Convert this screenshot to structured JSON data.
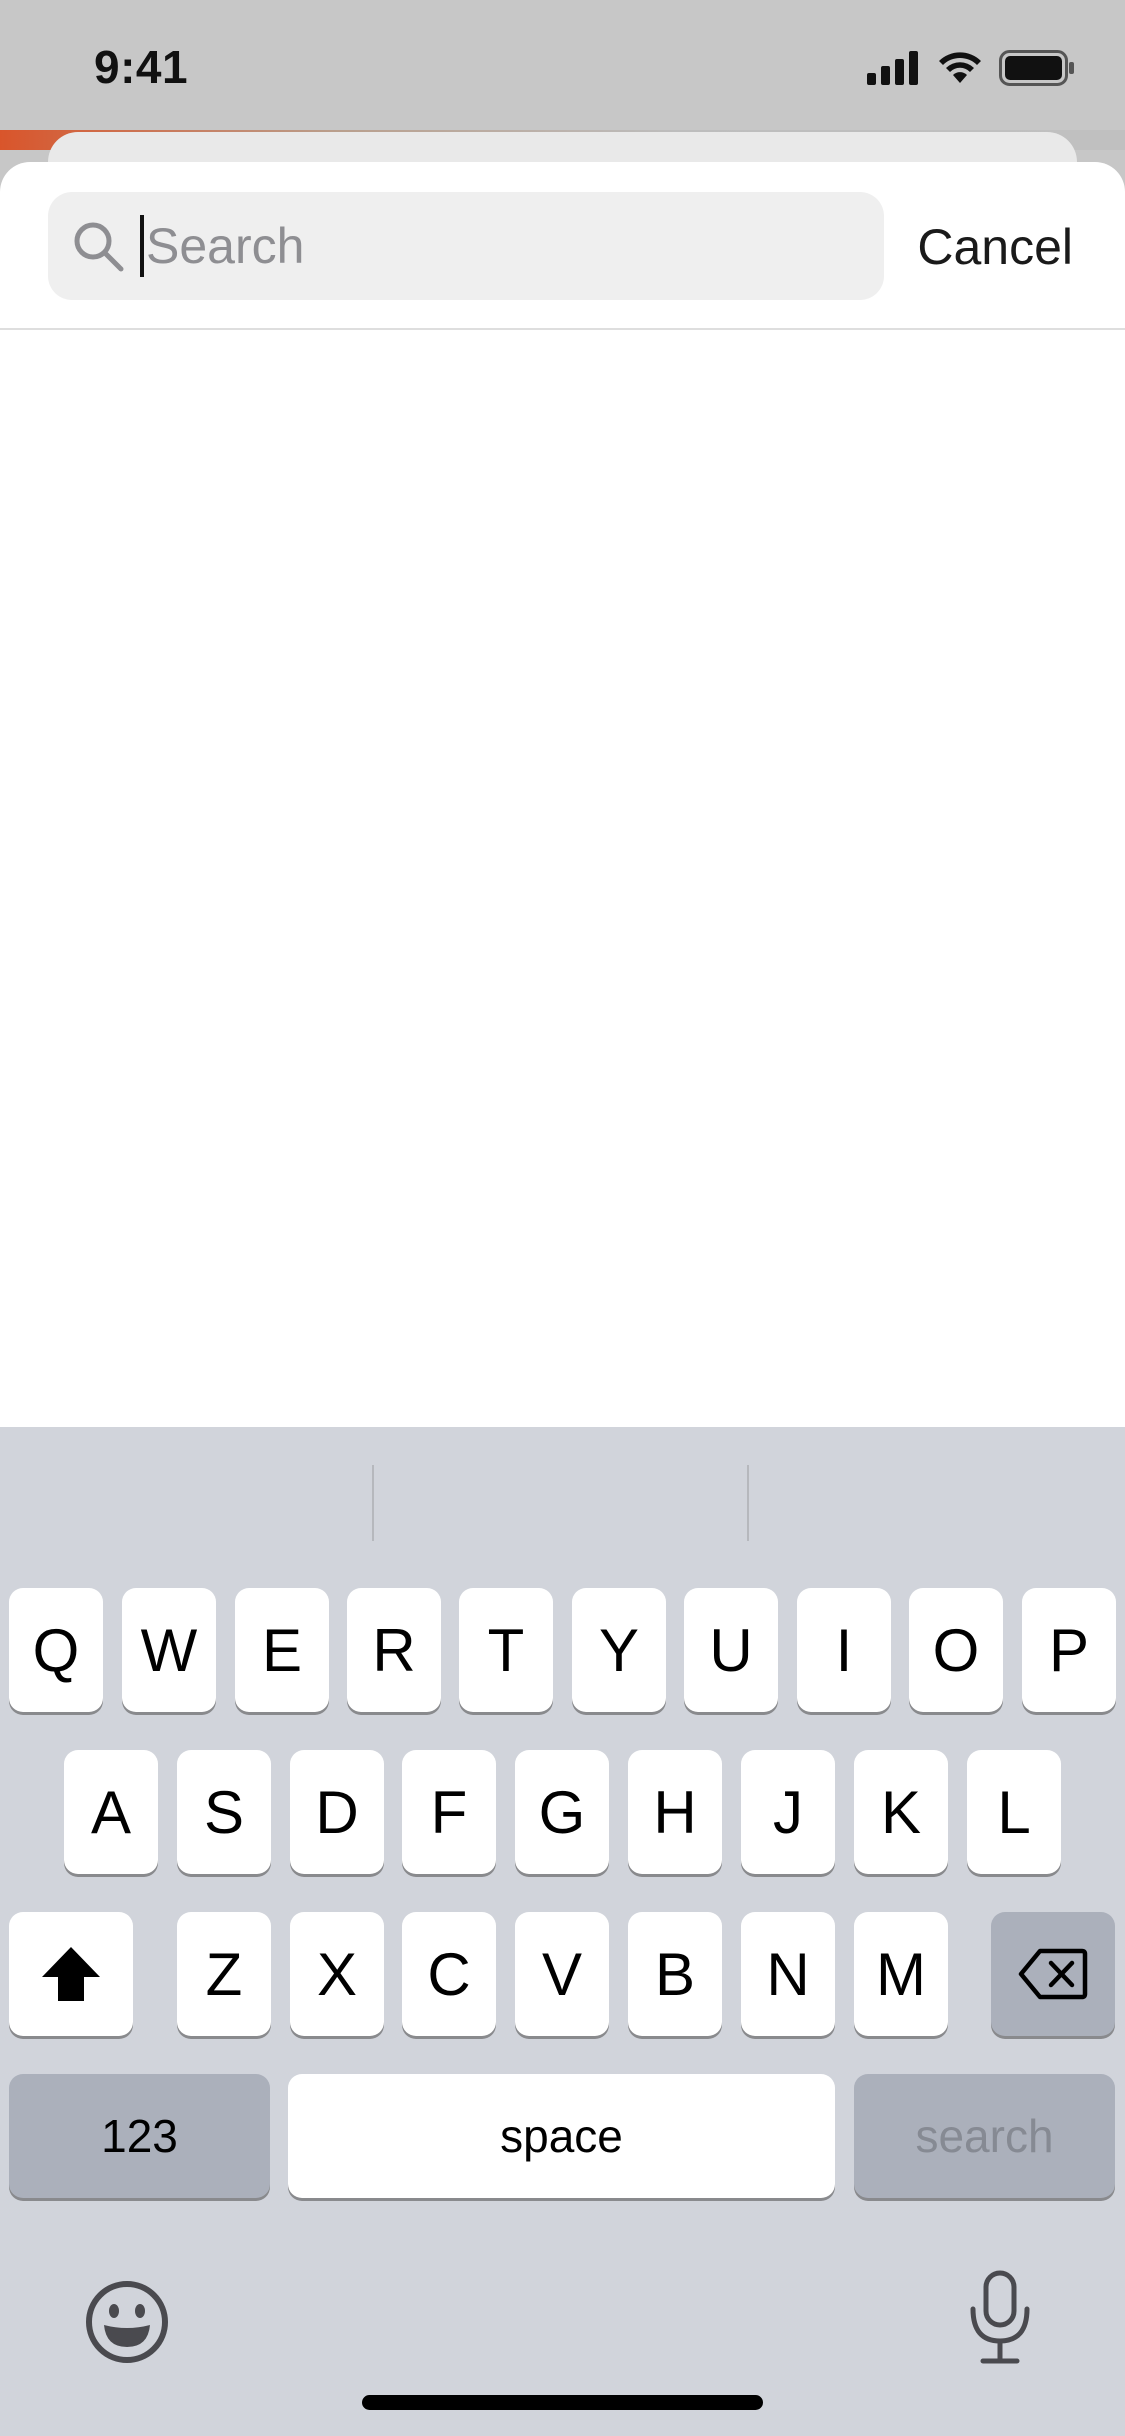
{
  "status_bar": {
    "time": "9:41"
  },
  "search": {
    "placeholder": "Search",
    "value": "",
    "cancel_label": "Cancel"
  },
  "keyboard": {
    "row1": [
      "Q",
      "W",
      "E",
      "R",
      "T",
      "Y",
      "U",
      "I",
      "O",
      "P"
    ],
    "row2": [
      "A",
      "S",
      "D",
      "F",
      "G",
      "H",
      "J",
      "K",
      "L"
    ],
    "row3": [
      "Z",
      "X",
      "C",
      "V",
      "B",
      "N",
      "M"
    ],
    "numbers_label": "123",
    "space_label": "space",
    "return_label": "search",
    "shift_icon": "shift-icon",
    "delete_icon": "delete-icon",
    "emoji_icon": "emoji-icon",
    "mic_icon": "microphone-icon"
  },
  "colors": {
    "keyboard_bg": "#d1d4db",
    "key_bg": "#ffffff",
    "function_key_bg": "#abb0bb",
    "accent": "#d9552b"
  }
}
